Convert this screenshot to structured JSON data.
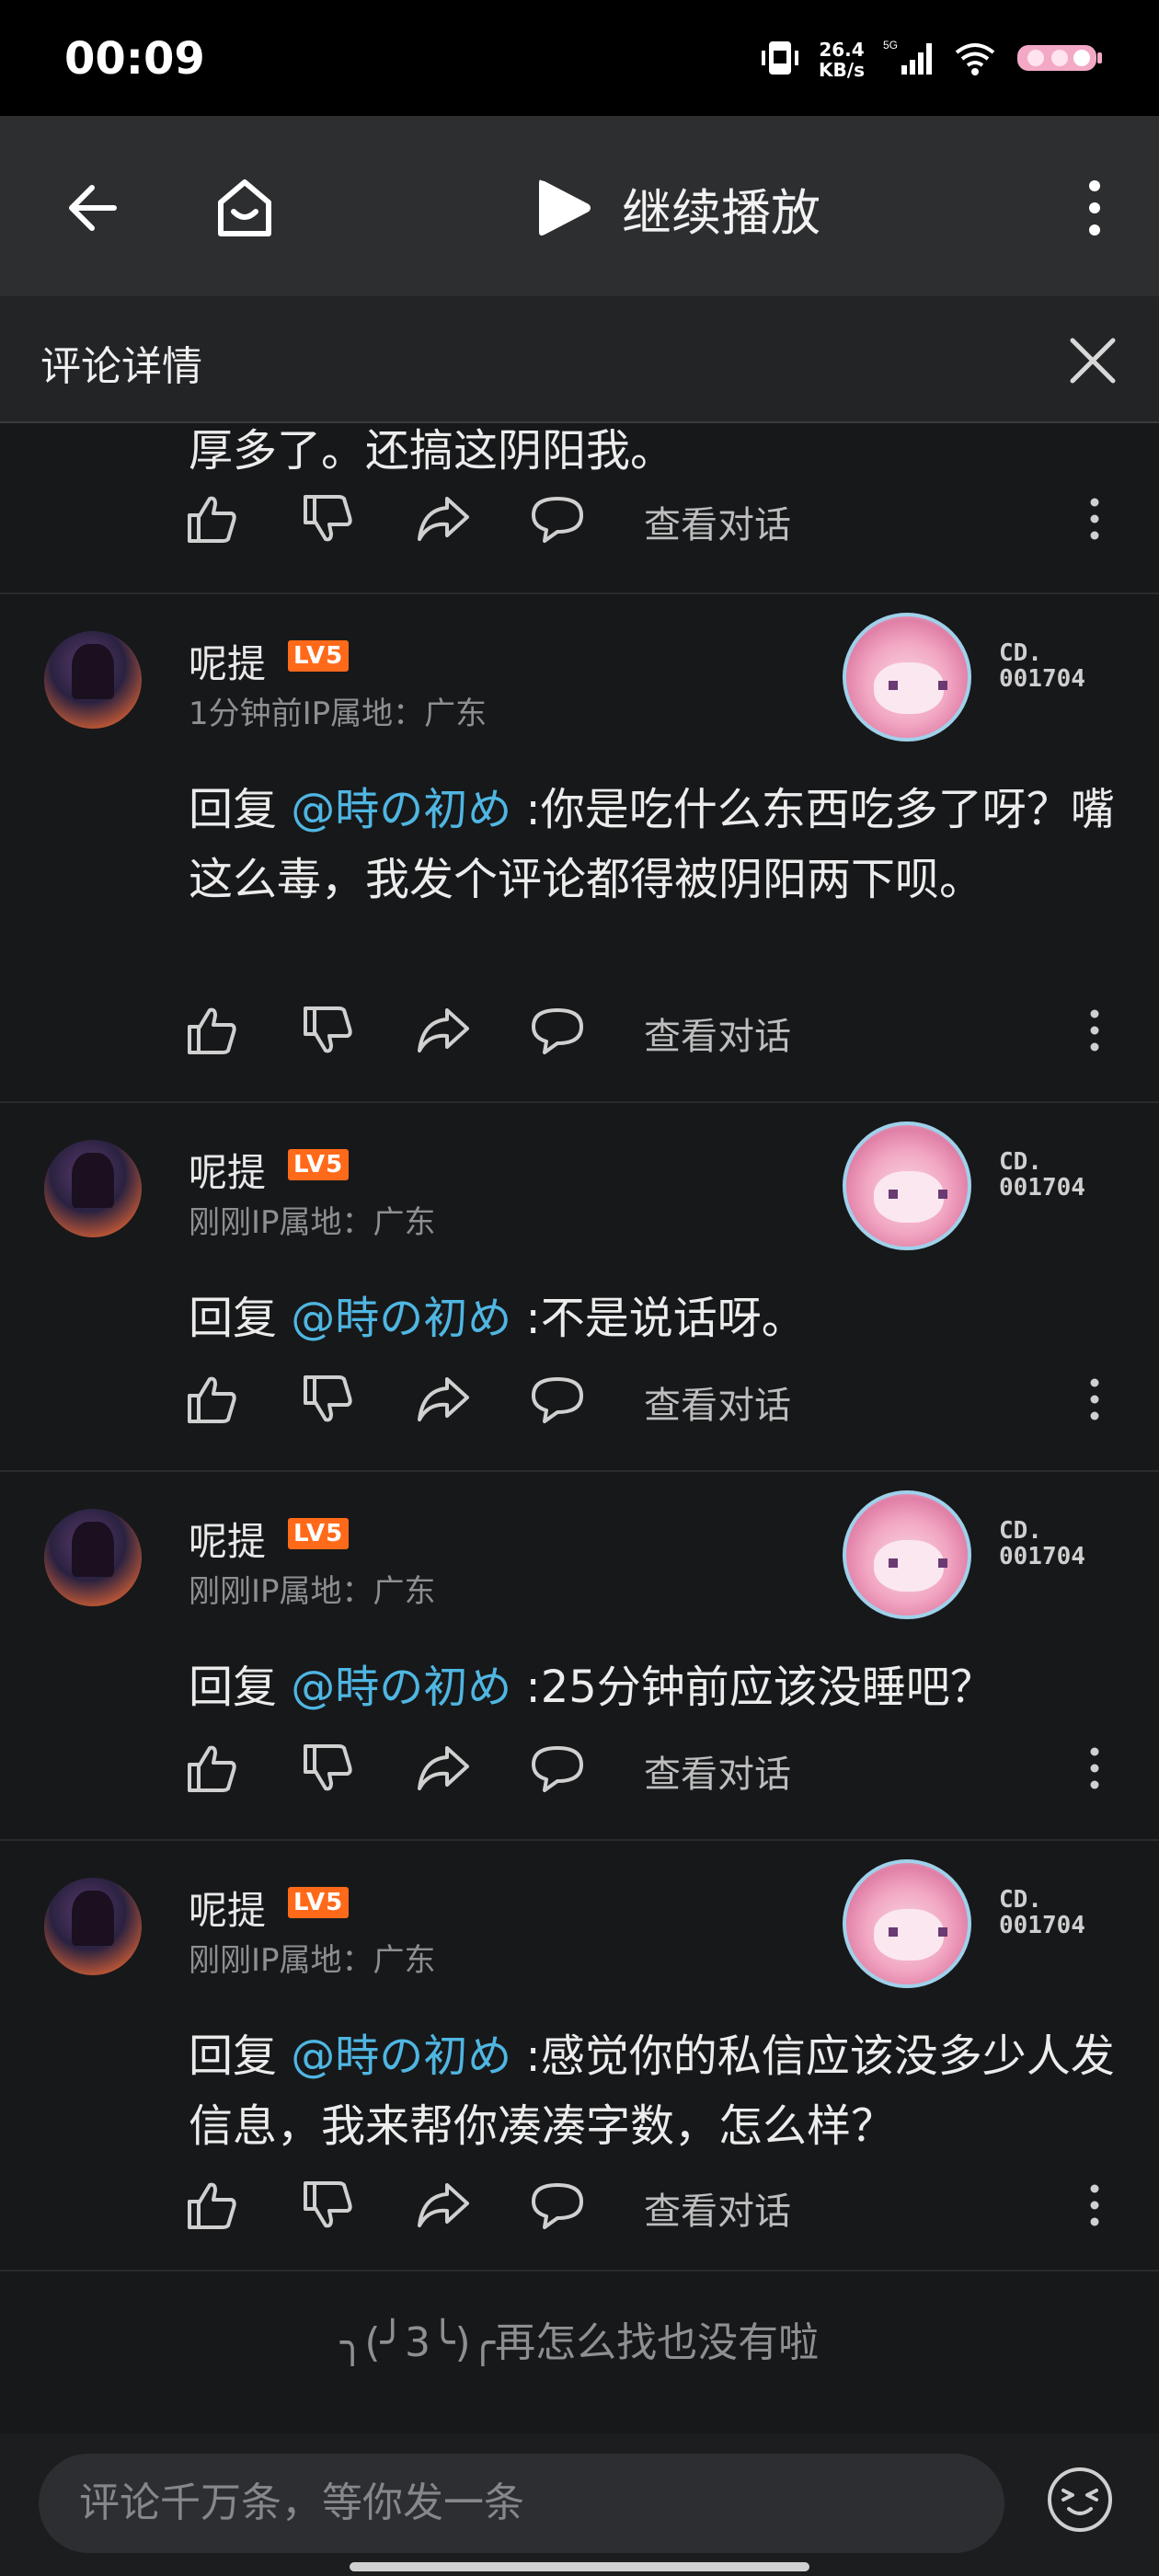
{
  "status_bar": {
    "time": "00:09",
    "net_speed_value": "26.4",
    "net_speed_unit": "KB/s",
    "network": "5G"
  },
  "top_bar": {
    "continue_label": "继续播放"
  },
  "detail_header": {
    "title": "评论详情"
  },
  "partial_comment": {
    "text": "厚多了。还搞这阴阳我。",
    "view_conversation": "查看对话"
  },
  "comments": [
    {
      "username": "呢提",
      "level": "LV5",
      "time": "1分钟前",
      "ip_label": "IP属地：广东",
      "badge_code": "CD.\n001704",
      "reply_prefix": "回复 ",
      "mention": "@時の初め",
      "text": " :你是吃什么东西吃多了呀？嘴这么毒，我发个评论都得被阴阳两下呗。",
      "view_conversation": "查看对话"
    },
    {
      "username": "呢提",
      "level": "LV5",
      "time": "刚刚",
      "ip_label": "IP属地：广东",
      "badge_code": "CD.\n001704",
      "reply_prefix": "回复 ",
      "mention": "@時の初め",
      "text": " :不是说话呀。",
      "view_conversation": "查看对话"
    },
    {
      "username": "呢提",
      "level": "LV5",
      "time": "刚刚",
      "ip_label": "IP属地：广东",
      "badge_code": "CD.\n001704",
      "reply_prefix": "回复 ",
      "mention": "@時の初め",
      "text": " :25分钟前应该没睡吧？",
      "view_conversation": "查看对话"
    },
    {
      "username": "呢提",
      "level": "LV5",
      "time": "刚刚",
      "ip_label": "IP属地：广东",
      "badge_code": "CD.\n001704",
      "reply_prefix": "回复 ",
      "mention": "@時の初め",
      "text": " :感觉你的私信应该没多少人发信息，我来帮你凑凑字数，怎么样？",
      "view_conversation": "查看对话"
    }
  ],
  "end_note": "╮(╯3╰)╭再怎么找也没有啦",
  "bottom_bar": {
    "input_placeholder": "评论千万条，等你发一条"
  },
  "icons": {
    "back": "arrow-left-icon",
    "home": "home-icon",
    "play": "play-icon",
    "more": "more-vertical-icon",
    "close": "close-icon",
    "like": "thumbs-up-icon",
    "dislike": "thumbs-down-icon",
    "share": "share-icon",
    "reply": "comment-bubble-icon",
    "emoji": "emoji-icon"
  },
  "colors": {
    "background": "#17181a",
    "mention": "#4fb6e2",
    "level_badge": "#ff6a1a",
    "meta_text": "#8e8f91"
  }
}
